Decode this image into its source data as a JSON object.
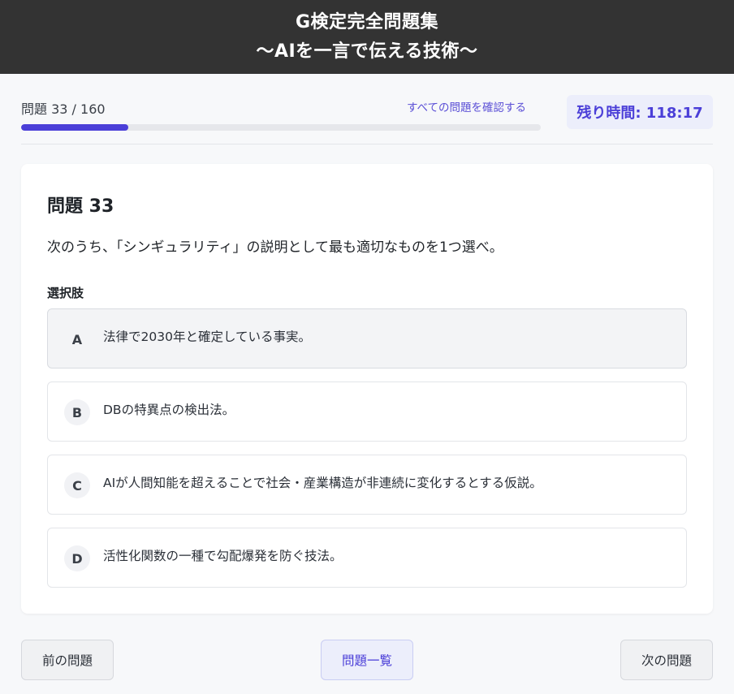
{
  "header": {
    "title_line1": "G検定完全問題集",
    "title_line2": "〜AIを一言で伝える技術〜"
  },
  "progress": {
    "counter": "問題 33 / 160",
    "current": 33,
    "total": 160,
    "view_all_label": "すべての問題を確認する",
    "timer": "残り時間: 118:17"
  },
  "question": {
    "title": "問題 33",
    "text": "次のうち、「シンギュラリティ」の説明として最も適切なものを1つ選べ。",
    "choices_label": "選択肢",
    "choices": [
      {
        "letter": "A",
        "text": "法律で2030年と確定している事実。"
      },
      {
        "letter": "B",
        "text": "DBの特異点の検出法。"
      },
      {
        "letter": "C",
        "text": "AIが人間知能を超えることで社会・産業構造が非連続に変化するとする仮説。"
      },
      {
        "letter": "D",
        "text": "活性化関数の一種で勾配爆発を防ぐ技法。"
      }
    ]
  },
  "nav": {
    "prev_label": "前の問題",
    "list_label": "問題一覧",
    "next_label": "次の問題"
  },
  "colors": {
    "header_bg": "#333333",
    "accent": "#4b3fd8",
    "accent_light": "#eceefb"
  }
}
